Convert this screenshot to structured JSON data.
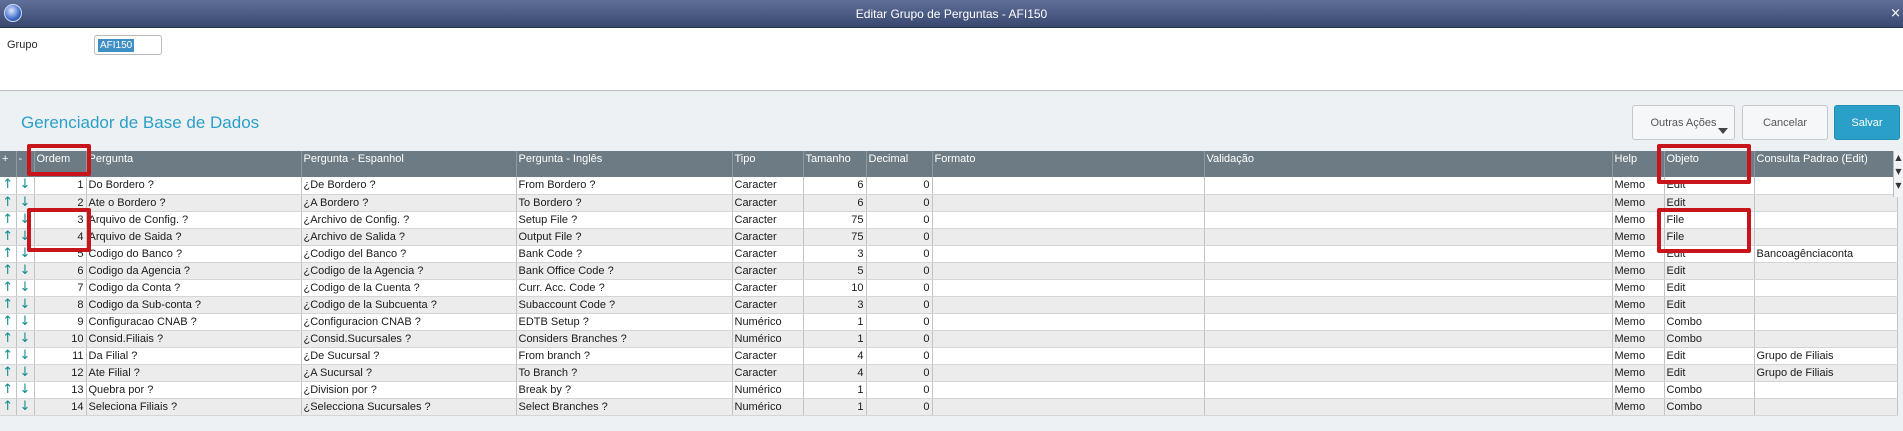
{
  "window": {
    "title": "Editar Grupo de Perguntas - AFI150",
    "close_glyph": "×"
  },
  "group": {
    "label": "Grupo",
    "value": "AFI150"
  },
  "header": {
    "title": "Gerenciador de Base de Dados"
  },
  "buttons": {
    "outras": "Outras Ações",
    "cancelar": "Cancelar",
    "salvar": "Salvar"
  },
  "table": {
    "columns": [
      "+",
      "-",
      "Ordem",
      "Pergunta",
      "Pergunta - Espanhol",
      "Pergunta - Inglês",
      "Tipo",
      "Tamanho",
      "Decimal",
      "Formato",
      "Validação",
      "Help",
      "Objeto",
      "Consulta Padrao (Edit)"
    ],
    "rows": [
      {
        "ordem": "1",
        "pergunta": "Do Bordero ?",
        "espanhol": "¿De Bordero ?",
        "ingles": "From Bordero ?",
        "tipo": "Caracter",
        "tamanho": "6",
        "decimal": "0",
        "help": "Memo",
        "objeto": "Edit",
        "consulta": ""
      },
      {
        "ordem": "2",
        "pergunta": "Ate o Bordero ?",
        "espanhol": "¿A Bordero ?",
        "ingles": "To Bordero ?",
        "tipo": "Caracter",
        "tamanho": "6",
        "decimal": "0",
        "help": "Memo",
        "objeto": "Edit",
        "consulta": ""
      },
      {
        "ordem": "3",
        "pergunta": "Arquivo de Config. ?",
        "espanhol": "¿Archivo de Config. ?",
        "ingles": "Setup File ?",
        "tipo": "Caracter",
        "tamanho": "75",
        "decimal": "0",
        "help": "Memo",
        "objeto": "File",
        "consulta": ""
      },
      {
        "ordem": "4",
        "pergunta": "Arquivo de Saida ?",
        "espanhol": "¿Archivo de Salida ?",
        "ingles": "Output File ?",
        "tipo": "Caracter",
        "tamanho": "75",
        "decimal": "0",
        "help": "Memo",
        "objeto": "File",
        "consulta": ""
      },
      {
        "ordem": "5",
        "pergunta": "Codigo do Banco ?",
        "espanhol": "¿Codigo del Banco ?",
        "ingles": "Bank Code ?",
        "tipo": "Caracter",
        "tamanho": "3",
        "decimal": "0",
        "help": "Memo",
        "objeto": "Edit",
        "consulta": "Bancoagênciaconta"
      },
      {
        "ordem": "6",
        "pergunta": "Codigo da Agencia ?",
        "espanhol": "¿Codigo de la Agencia ?",
        "ingles": "Bank Office Code ?",
        "tipo": "Caracter",
        "tamanho": "5",
        "decimal": "0",
        "help": "Memo",
        "objeto": "Edit",
        "consulta": ""
      },
      {
        "ordem": "7",
        "pergunta": "Codigo da Conta ?",
        "espanhol": "¿Codigo de la Cuenta ?",
        "ingles": "Curr. Acc. Code ?",
        "tipo": "Caracter",
        "tamanho": "10",
        "decimal": "0",
        "help": "Memo",
        "objeto": "Edit",
        "consulta": ""
      },
      {
        "ordem": "8",
        "pergunta": "Codigo da Sub-conta ?",
        "espanhol": "¿Codigo de la Subcuenta ?",
        "ingles": "Subaccount Code ?",
        "tipo": "Caracter",
        "tamanho": "3",
        "decimal": "0",
        "help": "Memo",
        "objeto": "Edit",
        "consulta": ""
      },
      {
        "ordem": "9",
        "pergunta": "Configuracao CNAB ?",
        "espanhol": "¿Configuracion CNAB ?",
        "ingles": "EDTB Setup ?",
        "tipo": "Numérico",
        "tamanho": "1",
        "decimal": "0",
        "help": "Memo",
        "objeto": "Combo",
        "consulta": ""
      },
      {
        "ordem": "10",
        "pergunta": "Consid.Filiais ?",
        "espanhol": "¿Consid.Sucursales ?",
        "ingles": "Considers Branches ?",
        "tipo": "Numérico",
        "tamanho": "1",
        "decimal": "0",
        "help": "Memo",
        "objeto": "Combo",
        "consulta": ""
      },
      {
        "ordem": "11",
        "pergunta": "Da Filial ?",
        "espanhol": "¿De Sucursal ?",
        "ingles": "From branch ?",
        "tipo": "Caracter",
        "tamanho": "4",
        "decimal": "0",
        "help": "Memo",
        "objeto": "Edit",
        "consulta": "Grupo de Filiais"
      },
      {
        "ordem": "12",
        "pergunta": "Ate Filial ?",
        "espanhol": "¿A Sucursal ?",
        "ingles": "To Branch ?",
        "tipo": "Caracter",
        "tamanho": "4",
        "decimal": "0",
        "help": "Memo",
        "objeto": "Edit",
        "consulta": "Grupo de Filiais"
      },
      {
        "ordem": "13",
        "pergunta": "Quebra por ?",
        "espanhol": "¿Division por ?",
        "ingles": "Break by ?",
        "tipo": "Numérico",
        "tamanho": "1",
        "decimal": "0",
        "help": "Memo",
        "objeto": "Combo",
        "consulta": ""
      },
      {
        "ordem": "14",
        "pergunta": "Seleciona Filiais ?",
        "espanhol": "¿Selecciona Sucursales ?",
        "ingles": "Select Branches ?",
        "tipo": "Numérico",
        "tamanho": "1",
        "decimal": "0",
        "help": "Memo",
        "objeto": "Combo",
        "consulta": ""
      }
    ]
  },
  "icons": {
    "up": "↑",
    "down": "↓",
    "up_name": "arrow-up-icon",
    "down_name": "arrow-down-icon"
  },
  "colors": {
    "accent": "#2aa0c9",
    "highlight": "#c8141b",
    "arrow": "#0e8a8f",
    "header_bg": "#6d7c84"
  }
}
